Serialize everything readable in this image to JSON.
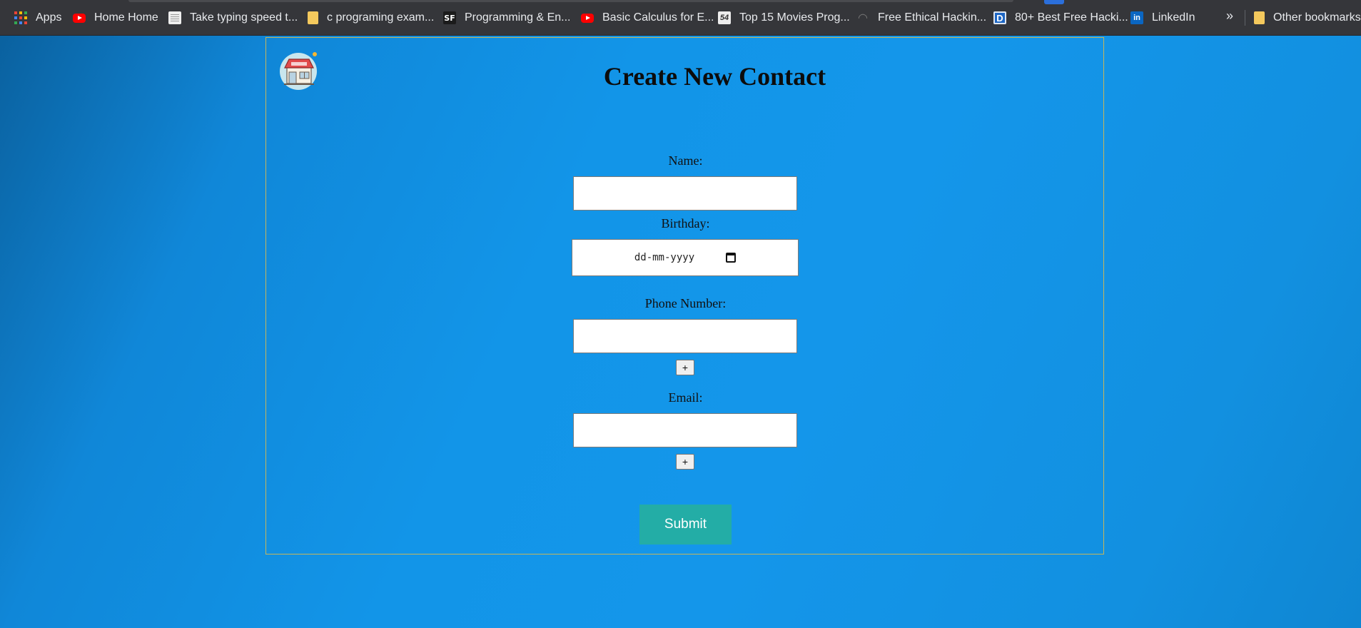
{
  "bookmarks": {
    "items": [
      {
        "label": "Apps",
        "icon": "apps-grid-icon"
      },
      {
        "label": "Home Home",
        "icon": "youtube-icon"
      },
      {
        "label": "Take typing speed t...",
        "icon": "document-icon"
      },
      {
        "label": "c programing exam...",
        "icon": "folder-icon"
      },
      {
        "label": "Programming & En...",
        "icon": "sf-icon"
      },
      {
        "label": "Basic Calculus for E...",
        "icon": "youtube-icon"
      },
      {
        "label": "Top 15 Movies Prog...",
        "icon": "site-54-icon"
      },
      {
        "label": "Free Ethical Hackin...",
        "icon": "gauge-icon"
      },
      {
        "label": "80+ Best Free Hacki...",
        "icon": "d-letter-icon"
      },
      {
        "label": "LinkedIn",
        "icon": "linkedin-icon"
      }
    ],
    "more": "»",
    "other": "Other bookmarks"
  },
  "page": {
    "title": "Create New Contact"
  },
  "form": {
    "name_label": "Name:",
    "name_value": "",
    "birthday_label": "Birthday:",
    "birthday_placeholder": "dd-mm-yyyy",
    "phone_label": "Phone Number:",
    "phone_value": "",
    "add_phone_label": "+",
    "email_label": "Email:",
    "email_value": "",
    "add_email_label": "+",
    "submit_label": "Submit"
  },
  "colors": {
    "background": "#1496ea",
    "submit": "#23ada6",
    "panel_border": "#c6b65a",
    "bookmarks_bar": "#35363a"
  }
}
